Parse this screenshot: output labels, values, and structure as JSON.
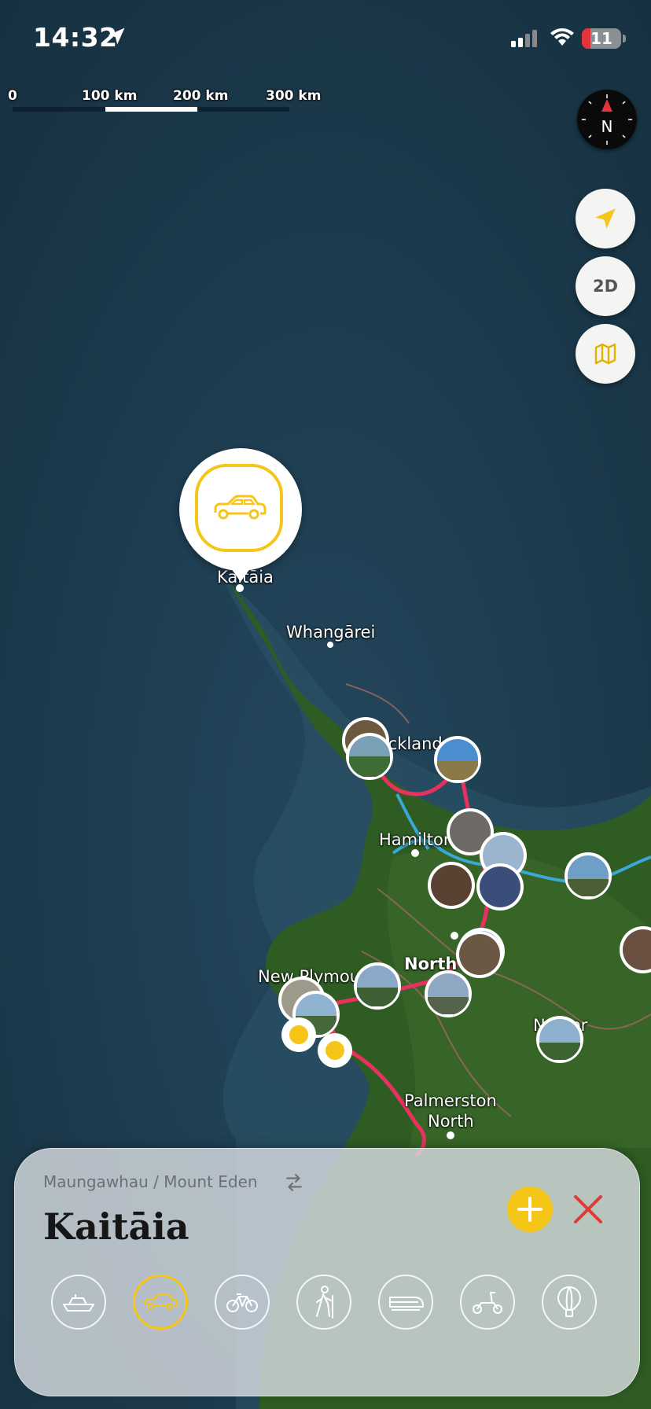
{
  "status_bar": {
    "time": "14:32",
    "battery_level": "11"
  },
  "scale": {
    "labels": [
      "0",
      "100 km",
      "200 km",
      "300 km"
    ]
  },
  "compass": {
    "letter": "N"
  },
  "controls": {
    "view_toggle_label": "2D"
  },
  "map_labels": {
    "kaitaia": "Kaitāia",
    "whangarei": "Whangārei",
    "auckland": "Auckland",
    "hamilton": "Hamilton",
    "new_plymouth": "New Plymouth",
    "north_island": "North",
    "napier": "Napier",
    "palmerston_north_1": "Palmerston",
    "palmerston_north_2": "North"
  },
  "selected_pin": {
    "mode_icon": "car-icon"
  },
  "trip_panel": {
    "from_label": "Maungawhau / Mount Eden",
    "destination_title": "Kaitāia",
    "selected_mode": "car",
    "modes": [
      "boat",
      "car",
      "bicycle",
      "hiking",
      "train",
      "scooter",
      "hot-air-balloon"
    ]
  },
  "colors": {
    "accent_yellow": "#F5C518",
    "route_red": "#E8315F",
    "route_blue": "#3BA7D4",
    "close_red": "#E03A36",
    "sea": "#1F3A4D",
    "land": "#2E5A22"
  }
}
